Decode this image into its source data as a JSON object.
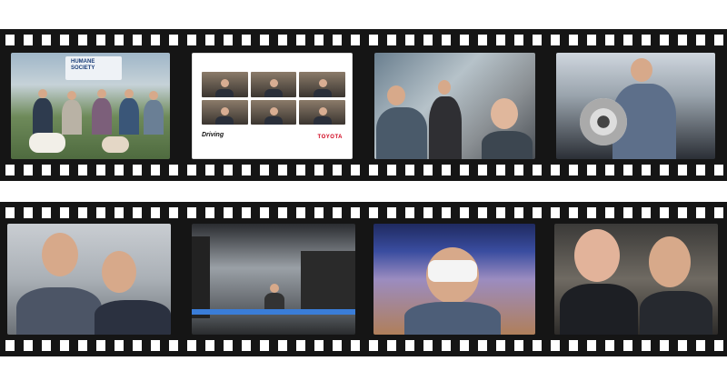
{
  "strips": [
    {
      "frames": [
        {
          "name": "photo-humane-society-group",
          "sign_text": "HUMANE\nSOCIETY"
        },
        {
          "name": "photo-video-call-grid",
          "brand_left": "Driving",
          "brand_right": "TOYOTA"
        },
        {
          "name": "photo-meeting-selfie"
        },
        {
          "name": "photo-brake-rotor"
        }
      ]
    },
    {
      "frames": [
        {
          "name": "photo-warehouse-selfie"
        },
        {
          "name": "photo-audio-showroom"
        },
        {
          "name": "photo-vr-headset"
        },
        {
          "name": "photo-two-men-selfie"
        }
      ]
    }
  ]
}
